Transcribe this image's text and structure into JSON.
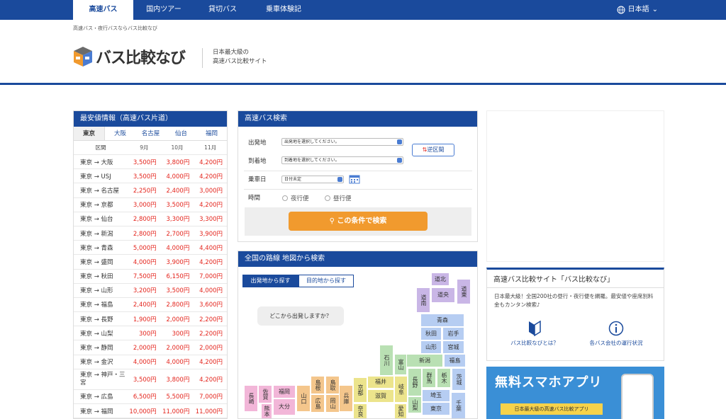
{
  "nav": {
    "tabs": [
      "高速バス",
      "国内ツアー",
      "貸切バス",
      "乗車体験記"
    ],
    "lang": "日本語"
  },
  "breadcrumb": "高速バス・夜行バスならバス比較なび",
  "logo": "バス比較なび",
  "tagline": [
    "日本最大級の",
    "高速バス比較サイト"
  ],
  "cheapest": {
    "title": "最安値情報（高速バス片道）",
    "cities": [
      "東京",
      "大阪",
      "名古屋",
      "仙台",
      "福岡"
    ],
    "headers": [
      "区間",
      "9月",
      "10月",
      "11月"
    ],
    "rows": [
      [
        "東京 → 大阪",
        "3,500円",
        "3,800円",
        "4,200円"
      ],
      [
        "東京 → USJ",
        "3,500円",
        "4,000円",
        "4,200円"
      ],
      [
        "東京 → 名古屋",
        "2,250円",
        "2,400円",
        "3,000円"
      ],
      [
        "東京 → 京都",
        "3,000円",
        "3,500円",
        "4,200円"
      ],
      [
        "東京 → 仙台",
        "2,800円",
        "3,300円",
        "3,300円"
      ],
      [
        "東京 → 新潟",
        "2,800円",
        "2,700円",
        "3,900円"
      ],
      [
        "東京 → 青森",
        "5,000円",
        "4,000円",
        "4,400円"
      ],
      [
        "東京 → 盛岡",
        "4,000円",
        "3,900円",
        "4,200円"
      ],
      [
        "東京 → 秋田",
        "7,500円",
        "6,150円",
        "7,000円"
      ],
      [
        "東京 → 山形",
        "3,200円",
        "3,500円",
        "4,000円"
      ],
      [
        "東京 → 福島",
        "2,400円",
        "2,800円",
        "3,600円"
      ],
      [
        "東京 → 長野",
        "1,900円",
        "2,000円",
        "2,200円"
      ],
      [
        "東京 → 山梨",
        "300円",
        "300円",
        "2,200円"
      ],
      [
        "東京 → 静岡",
        "2,000円",
        "2,000円",
        "2,000円"
      ],
      [
        "東京 → 金沢",
        "4,000円",
        "4,000円",
        "4,200円"
      ],
      [
        "東京 → 神戸・三宮",
        "3,500円",
        "3,800円",
        "4,200円"
      ],
      [
        "東京 → 広島",
        "6,500円",
        "5,500円",
        "7,000円"
      ],
      [
        "東京 → 福岡",
        "10,000円",
        "11,000円",
        "11,000円"
      ]
    ]
  },
  "search": {
    "title": "高速バス検索",
    "dep_label": "出発地",
    "dep_value": "出発地を選択してください。",
    "arr_label": "到着地",
    "arr_value": "到着地を選択してください。",
    "swap": "逆区間",
    "date_label": "乗車日",
    "date_value": "日付未定",
    "time_label": "時間",
    "opt1": "夜行便",
    "opt2": "昼行便",
    "button": "この条件で検索"
  },
  "map": {
    "title": "全国の路線 地図から検索",
    "tab_from": "出発地から探す",
    "tab_to": "目的地から探す",
    "bubble": "どこから出発しますか？",
    "prefs": [
      "道北",
      "道東",
      "道央",
      "道南",
      "青森",
      "秋田",
      "岩手",
      "山形",
      "宮城",
      "新潟",
      "福島",
      "石川",
      "富山",
      "長野",
      "群馬",
      "栃木",
      "茨城",
      "福井",
      "岐阜",
      "山梨",
      "埼玉",
      "東京",
      "千葉",
      "京都",
      "滋賀",
      "兵庫",
      "鳥取",
      "岡山",
      "島根",
      "広島",
      "山口",
      "福岡",
      "佐賀",
      "長崎",
      "大分",
      "熊本",
      "奈良",
      "愛知"
    ]
  },
  "about": {
    "title": "高速バス比較サイト「バス比較なび」",
    "desc": "日本最大級！全国200社の昼行・夜行便を網羅。最安値や座席別料金もカンタン検索♪",
    "link1": "バス比較なびとは？",
    "link2": "各バス会社の運行状況"
  },
  "app": {
    "title": "無料スマホアプリ",
    "banner": "日本最大級の高速バス比較アプリ"
  }
}
